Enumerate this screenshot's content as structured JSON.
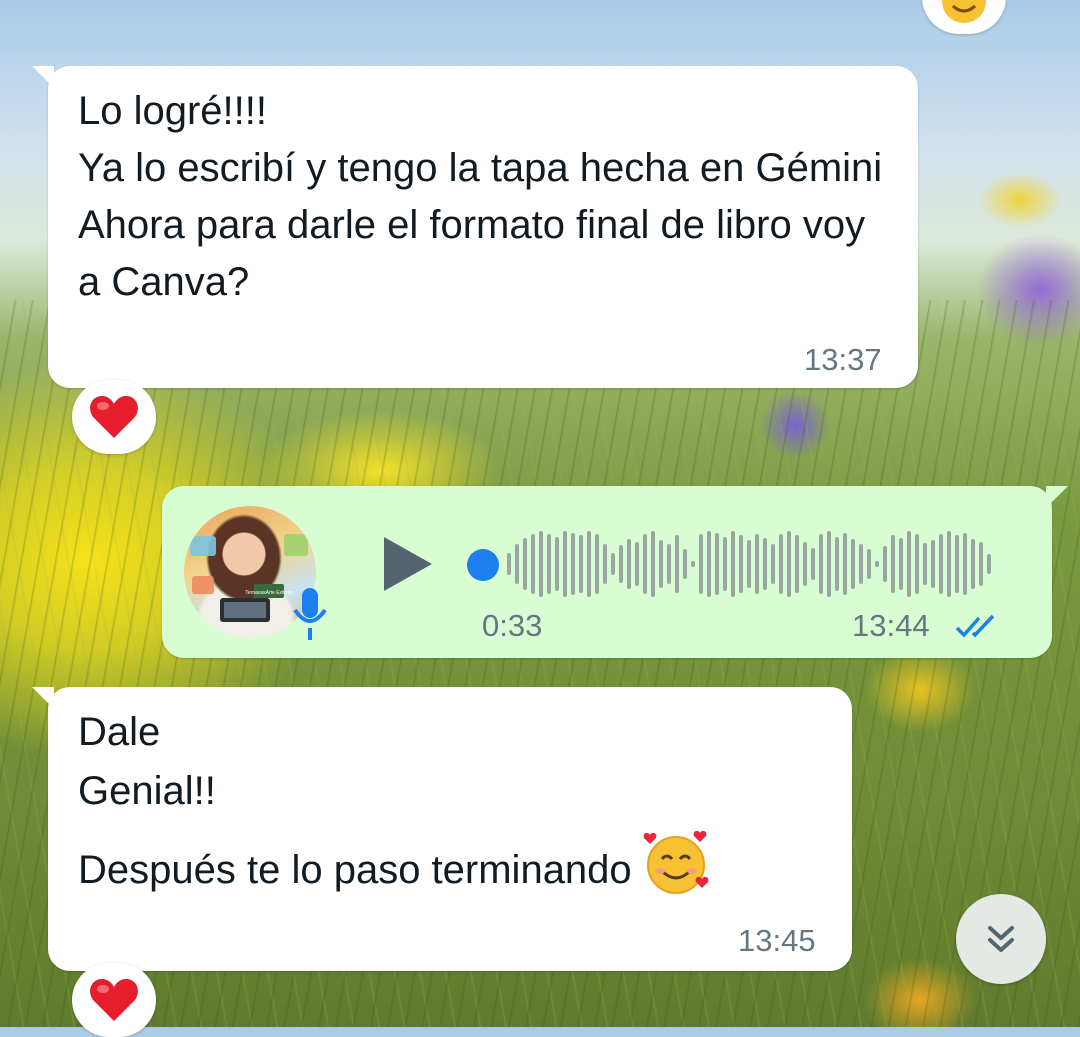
{
  "messages": [
    {
      "direction": "incoming",
      "text": "Lo logré!!!!\nYa lo escribí y tengo la tapa hecha en Gémini\nAhora para darle el formato final de libro voy a Canva?",
      "time": "13:37",
      "reaction": "heart-emoji"
    },
    {
      "direction": "outgoing",
      "type": "voice",
      "duration": "0:33",
      "time": "13:44",
      "status": "read-double-check",
      "playback_progress": 0,
      "avatar_caption": "TernavasArte Exitoso"
    },
    {
      "direction": "incoming",
      "lines": [
        "Dale",
        "Genial!!",
        "Después te lo paso terminando"
      ],
      "trailing_emoji": "smiling-face-with-hearts",
      "time": "13:45",
      "reaction": "heart-emoji"
    }
  ],
  "top_reaction": "smiling-face-with-hearts",
  "colors": {
    "incoming_bubble": "#ffffff",
    "outgoing_bubble": "#d9fdd3",
    "timestamp": "#667781",
    "read_ticks": "#1d7ff0",
    "progress_dot": "#1d7ff0"
  },
  "scroll_button_icon": "double-chevron-down-icon"
}
